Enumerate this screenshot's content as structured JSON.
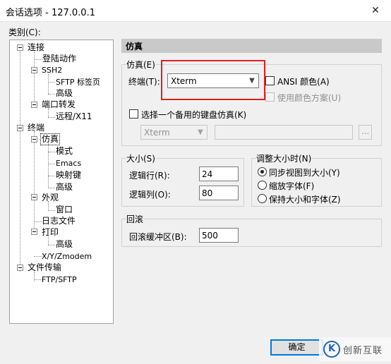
{
  "window": {
    "title": "会话选项 - 127.0.0.1",
    "close": "✕"
  },
  "category_label": "类别(C):",
  "tree": [
    {
      "label": "连接"
    },
    {
      "label": "登陆动作"
    },
    {
      "label": "SSH2"
    },
    {
      "label": "SFTP 标签页"
    },
    {
      "label": "高级"
    },
    {
      "label": "端口转发"
    },
    {
      "label": "远程/X11"
    },
    {
      "label": "终端"
    },
    {
      "label": "仿真",
      "selected": true
    },
    {
      "label": "模式"
    },
    {
      "label": "Emacs"
    },
    {
      "label": "映射键"
    },
    {
      "label": "高级"
    },
    {
      "label": "外观"
    },
    {
      "label": "窗口"
    },
    {
      "label": "日志文件"
    },
    {
      "label": "打印"
    },
    {
      "label": "高级"
    },
    {
      "label": "X/Y/Zmodem"
    },
    {
      "label": "文件传输"
    },
    {
      "label": "FTP/SFTP"
    }
  ],
  "panel": {
    "header": "仿真",
    "emulation": {
      "legend": "仿真(E)",
      "terminal_label": "终端(T):",
      "terminal_value": "Xterm",
      "ansi_color": "ANSI 颜色(A)",
      "use_color_scheme": "使用颜色方案(U)",
      "alt_keyboard": "选择一个备用的键盘仿真(K)",
      "alt_keyboard_value": "Xterm",
      "browse": "..."
    },
    "size": {
      "legend": "大小(S)",
      "rows_label": "逻辑行(R):",
      "rows_value": "24",
      "cols_label": "逻辑列(O):",
      "cols_value": "80"
    },
    "resize": {
      "legend": "调整大小时(N)",
      "option_sync": "同步视图到大小(Y)",
      "option_scale": "缩放字体(F)",
      "option_keep": "保持大小和字体(Z)",
      "selected": "同步视图到大小(Y)"
    },
    "scroll": {
      "legend": "回滚",
      "buffer_label": "回滚缓冲区(B):",
      "buffer_value": "500"
    }
  },
  "ok_button": "确定",
  "watermark": {
    "logo": "K",
    "text": "创新互联"
  },
  "colors": {
    "highlight": "#e02020",
    "header": "#c9c9c9",
    "focus": "#0078d7"
  }
}
